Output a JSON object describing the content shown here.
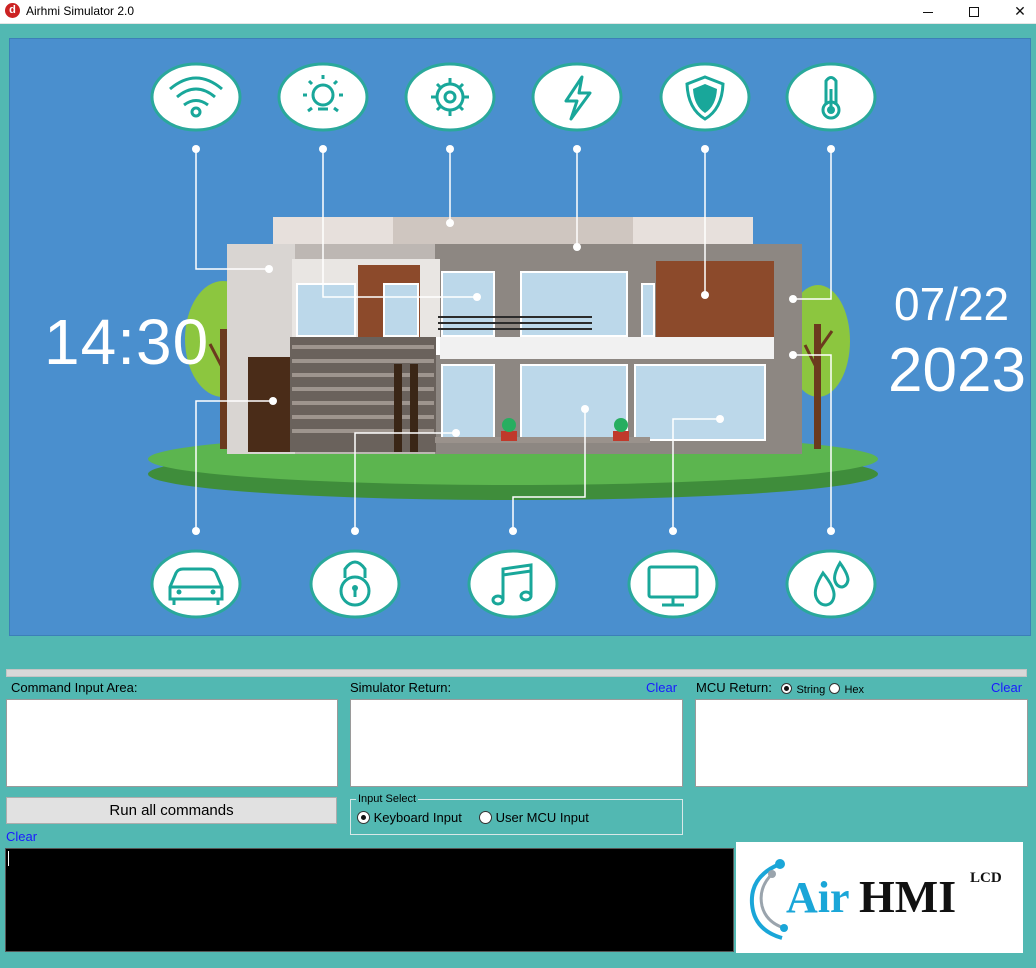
{
  "window": {
    "title": "Airhmi Simulator 2.0",
    "icon_letter": "d",
    "minimize_icon": "minimize-icon",
    "maximize_icon": "maximize-icon",
    "close_icon": "close-icon"
  },
  "hmi_screen": {
    "time": "14:30",
    "date": "07/22",
    "year": "2023",
    "top_icons": [
      "wifi-icon",
      "light-bulb-icon",
      "gear-icon",
      "lightning-icon",
      "shield-icon",
      "thermometer-icon"
    ],
    "bottom_icons": [
      "car-icon",
      "lock-icon",
      "music-icon",
      "monitor-icon",
      "water-drops-icon"
    ],
    "colors": {
      "background": "#4a8fce",
      "icon_circle": "#ffffff",
      "icon_stroke": "#19a79a",
      "lawn": "#4fa34b"
    }
  },
  "panels": {
    "command_input": {
      "label": "Command Input Area:",
      "value": ""
    },
    "simulator_return": {
      "label": "Simulator Return:",
      "clear": "Clear",
      "value": ""
    },
    "mcu_return": {
      "label": "MCU Return:",
      "clear": "Clear",
      "format_options": [
        {
          "label": "String",
          "selected": true
        },
        {
          "label": "Hex",
          "selected": false
        }
      ],
      "value": ""
    }
  },
  "run_button": {
    "label": "Run all commands"
  },
  "console_clear": "Clear",
  "input_select": {
    "title": "Input Select",
    "options": [
      {
        "label": "Keyboard Input",
        "selected": true
      },
      {
        "label": "User MCU Input",
        "selected": false
      }
    ]
  },
  "console": {
    "value": ""
  },
  "logo": {
    "text_air": "Air",
    "text_hmi": "HMI",
    "text_lcd": "LCD"
  },
  "theme": {
    "app_background": "#52b8b2",
    "link_color": "#1a1aff"
  }
}
